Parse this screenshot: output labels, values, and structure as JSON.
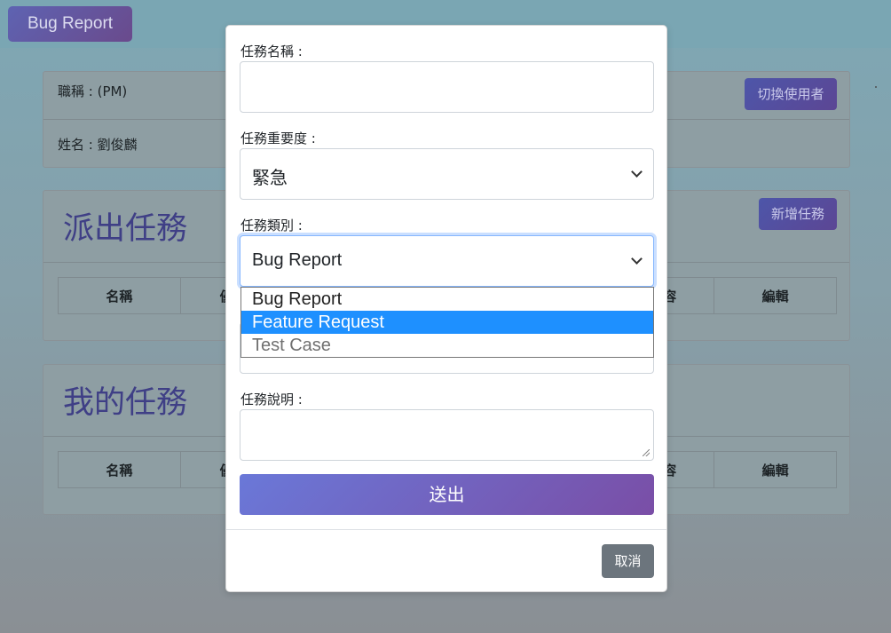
{
  "brand": "Bug Report",
  "user_info": {
    "title_label": "職稱 : (PM)",
    "name_label": "姓名 : 劉俊麟",
    "switch_user_button": "切換使用者"
  },
  "assigned_tasks": {
    "title": "派出任務",
    "add_button": "新增任務",
    "columns": [
      "名稱",
      "優先",
      "內容",
      "編輯"
    ]
  },
  "my_tasks": {
    "title": "我的任務",
    "columns": [
      "名稱",
      "優先",
      "內容",
      "編輯"
    ]
  },
  "modal": {
    "name_label": "任務名稱 :",
    "name_value": "",
    "priority_label": "任務重要度 :",
    "priority_value": "緊急",
    "category_label": "任務類別 :",
    "category_value": "Bug Report",
    "category_options": [
      "Bug Report",
      "Feature Request",
      "Test Case"
    ],
    "category_highlighted": "Feature Request",
    "description_label": "任務說明 :",
    "description_value": "",
    "submit_button": "送出",
    "cancel_button": "取消"
  },
  "colors": {
    "accent_gradient_start": "#6a78d8",
    "accent_gradient_end": "#7a4ea6",
    "dropdown_highlight": "#1e90ff",
    "cancel_button": "#6c757d"
  }
}
